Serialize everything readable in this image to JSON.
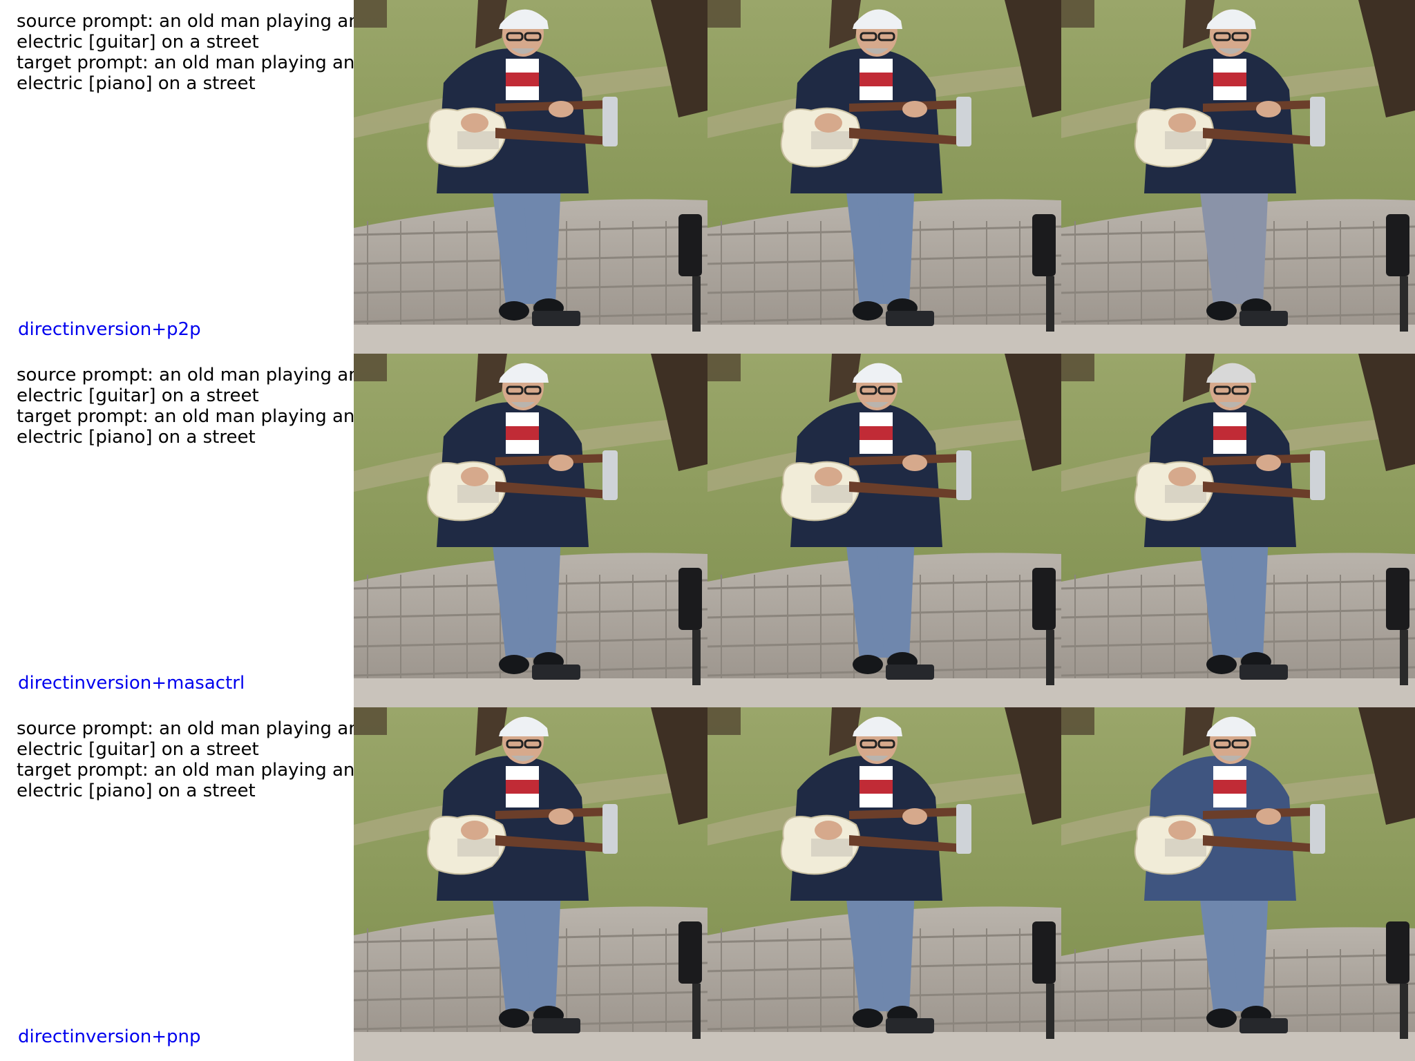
{
  "rows": [
    {
      "prompt_lines": [
        "source prompt: an old man playing an",
        "electric [guitar] on a street",
        "target prompt: an old man playing an",
        "electric [piano] on a street"
      ],
      "method": "directinversion+p2p"
    },
    {
      "prompt_lines": [
        "source prompt: an old man playing an",
        "electric [guitar] on a street",
        "target prompt: an old man playing an",
        "electric [piano] on a street"
      ],
      "method": "directinversion+masactrl"
    },
    {
      "prompt_lines": [
        "source prompt: an old man playing an",
        "electric [guitar] on a street",
        "target prompt: an old man playing an",
        "electric [piano] on a street"
      ],
      "method": "directinversion+pnp"
    }
  ],
  "colors": {
    "method_label": "#0000ee",
    "prompt_text": "#000000"
  },
  "images": {
    "descriptions": [
      "source-image",
      "reconstructed-image",
      "edited-image"
    ],
    "icon": "photo-icon"
  }
}
